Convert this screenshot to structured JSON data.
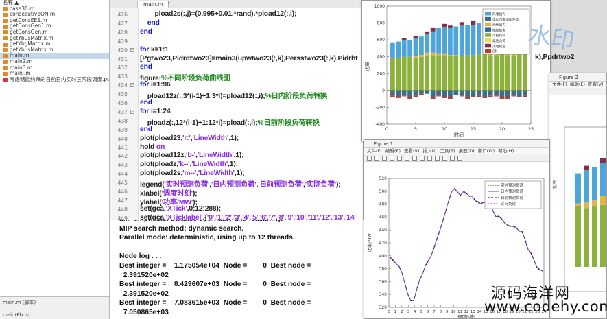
{
  "file_browser": {
    "items": [
      {
        "label": "名称 ▲",
        "type": "header"
      },
      {
        "label": "case30.m",
        "type": "m"
      },
      {
        "label": "consecutiveON.m",
        "type": "m"
      },
      {
        "label": "getConsEES.m",
        "type": "m"
      },
      {
        "label": "getConsGen1.m",
        "type": "m"
      },
      {
        "label": "getConsGen.m",
        "type": "m"
      },
      {
        "label": "getYbusMatrix.m",
        "type": "m"
      },
      {
        "label": "getYbgMatrix.m",
        "type": "m"
      },
      {
        "label": "getYbusMatrix.m",
        "type": "m"
      },
      {
        "label": "main.m",
        "type": "m",
        "selected": true
      },
      {
        "label": "main2.m",
        "type": "m"
      },
      {
        "label": "main3.m",
        "type": "m"
      },
      {
        "label": "mainj.m",
        "type": "m"
      },
      {
        "label": "考虑储能约束的日前日内实时三阶段调度.pdf",
        "type": "pdf"
      }
    ],
    "status_title": "main.m (脚本)",
    "status_sub": "main(Pbus)"
  },
  "editor": {
    "tab": "main.m",
    "tab_plus": "+",
    "lines": [
      {
        "n": "426",
        "fold": "",
        "t": [
          {
            "c": "",
            "s": "        pload2s(:,j)=(0.995+0.01.*rand).*pload12(:,i);"
          }
        ]
      },
      {
        "n": "427",
        "fold": "",
        "t": [
          {
            "c": "kw",
            "s": "    end"
          }
        ]
      },
      {
        "n": "428",
        "fold": "",
        "t": [
          {
            "c": "kw",
            "s": "end"
          }
        ]
      },
      {
        "n": "429",
        "fold": "",
        "t": [
          {
            "c": "",
            "s": ""
          }
        ]
      },
      {
        "n": "430",
        "fold": "−",
        "t": [
          {
            "c": "kw",
            "s": "for "
          },
          {
            "c": "",
            "s": "k=1:1"
          }
        ]
      },
      {
        "n": "431",
        "fold": "",
        "t": [
          {
            "c": "",
            "s": "[Pgtwo23,Pidrdtwo23]=main3(upwtwo23(:,k),Persstwo23(:,k),Pidrbt"
          }
        ]
      },
      {
        "n": "432",
        "fold": "",
        "t": [
          {
            "c": "kw",
            "s": "end"
          }
        ]
      },
      {
        "n": "433",
        "fold": "",
        "t": [
          {
            "c": "",
            "s": "figure;"
          },
          {
            "c": "cmt",
            "s": "%不同阶段负荷曲线图"
          }
        ]
      },
      {
        "n": "434",
        "fold": "−",
        "t": [
          {
            "c": "kw",
            "s": "for "
          },
          {
            "c": "",
            "s": "i=1:96"
          }
        ]
      },
      {
        "n": "435",
        "fold": "",
        "t": [
          {
            "c": "",
            "s": "    pload12z(:,3*(i-1)+1:3*i)=pload12(:,i);"
          },
          {
            "c": "cmt",
            "s": "%日内阶段负荷转换"
          }
        ]
      },
      {
        "n": "436",
        "fold": "",
        "t": [
          {
            "c": "kw",
            "s": "end"
          }
        ]
      },
      {
        "n": "437",
        "fold": "−",
        "t": [
          {
            "c": "kw",
            "s": "for "
          },
          {
            "c": "",
            "s": "i=1:24"
          }
        ]
      },
      {
        "n": "438",
        "fold": "",
        "t": [
          {
            "c": "",
            "s": "    ploadz(:,12*(i-1)+1:12*i)=pload(:,i);"
          },
          {
            "c": "cmt",
            "s": "%日前阶段负荷转换"
          }
        ]
      },
      {
        "n": "439",
        "fold": "",
        "t": [
          {
            "c": "kw",
            "s": "end"
          }
        ]
      },
      {
        "n": "440",
        "fold": "",
        "t": [
          {
            "c": "",
            "s": "plot(pload23,"
          },
          {
            "c": "str",
            "s": "'r:'"
          },
          {
            "c": "",
            "s": ","
          },
          {
            "c": "str",
            "s": "'LineWidth'"
          },
          {
            "c": "",
            "s": ",1);"
          }
        ]
      },
      {
        "n": "441",
        "fold": "",
        "t": [
          {
            "c": "",
            "s": "hold "
          },
          {
            "c": "str",
            "s": "on"
          }
        ]
      },
      {
        "n": "442",
        "fold": "",
        "t": [
          {
            "c": "",
            "s": "plot(pload12z,"
          },
          {
            "c": "str",
            "s": "'b-'"
          },
          {
            "c": "",
            "s": ","
          },
          {
            "c": "str",
            "s": "'LineWidth'"
          },
          {
            "c": "",
            "s": ",1);"
          }
        ]
      },
      {
        "n": "443",
        "fold": "",
        "t": [
          {
            "c": "",
            "s": "plot(ploadz,"
          },
          {
            "c": "str",
            "s": "'k--'"
          },
          {
            "c": "",
            "s": ","
          },
          {
            "c": "str",
            "s": "'LineWidth'"
          },
          {
            "c": "",
            "s": ",1);"
          }
        ]
      },
      {
        "n": "444",
        "fold": "",
        "t": [
          {
            "c": "",
            "s": "plot(pload2s,"
          },
          {
            "c": "str",
            "s": "'m--'"
          },
          {
            "c": "",
            "s": ","
          },
          {
            "c": "str",
            "s": "'LineWidth'"
          },
          {
            "c": "",
            "s": ",1);"
          }
        ]
      },
      {
        "n": "445",
        "fold": "",
        "t": [
          {
            "c": "",
            "s": "legend("
          },
          {
            "c": "str",
            "s": "'实时预测负荷'"
          },
          {
            "c": "",
            "s": ","
          },
          {
            "c": "str",
            "s": "'日内预测负荷'"
          },
          {
            "c": "",
            "s": ","
          },
          {
            "c": "str",
            "s": "'日前预测负荷'"
          },
          {
            "c": "",
            "s": ","
          },
          {
            "c": "str",
            "s": "'实际负荷'"
          },
          {
            "c": "",
            "s": ");"
          }
        ]
      },
      {
        "n": "446",
        "fold": "",
        "t": [
          {
            "c": "",
            "s": "xlabel("
          },
          {
            "c": "str",
            "s": "'调度时刻'"
          },
          {
            "c": "",
            "s": ");"
          }
        ]
      },
      {
        "n": "447",
        "fold": "",
        "t": [
          {
            "c": "",
            "s": "ylabel("
          },
          {
            "c": "str",
            "s": "'功率/MW'"
          },
          {
            "c": "",
            "s": ");"
          }
        ]
      },
      {
        "n": "448",
        "fold": "",
        "t": [
          {
            "c": "",
            "s": "set(gca,"
          },
          {
            "c": "str",
            "s": "'XTick'"
          },
          {
            "c": "",
            "s": ",0:12:288);"
          }
        ]
      },
      {
        "n": "449",
        "fold": "",
        "t": [
          {
            "c": "",
            "s": "set(gca,"
          },
          {
            "c": "str",
            "s": "'XTicklabel'"
          },
          {
            "c": "",
            "s": ",{"
          },
          {
            "c": "str",
            "s": "'0','1','2','3','4','5','6','7','8','9','10','11','12','13','14'"
          }
        ]
      }
    ],
    "overflow_text": "k),Ppdrtwo2"
  },
  "command_window": {
    "lines": [
      "MIP emphasis: balance optimality and feasibility.",
      "MIP search method: dynamic search.",
      "Parallel mode: deterministic, using up to 12 threads.",
      "",
      "Node log . . .",
      "Best integer =    1.175054e+04  Node =        0  Best node =",
      "  2.391520e+02",
      "Best integer =    8.429607e+03  Node =        0  Best node =",
      "  2.391520e+02",
      "Best integer =    7.083615e+03  Node =        0  Best node =",
      "  7.050865e+03"
    ]
  },
  "figure1": {
    "ylabel": "功率",
    "xlabel": "时间",
    "chart_data": {
      "type": "bar",
      "x": [
        1,
        2,
        3,
        4,
        5,
        6,
        7,
        8,
        9,
        10,
        11,
        12,
        13,
        14,
        15,
        16,
        17,
        18,
        19,
        20,
        21,
        22,
        23,
        24
      ],
      "xlim": [
        0,
        25
      ],
      "xticks": [
        "0",
        "5",
        "10",
        "15",
        "20",
        "25"
      ],
      "ylim": [
        -400,
        1000
      ],
      "yticks": [
        "-400",
        "-200",
        "0",
        "200",
        "400",
        "600",
        "800",
        "1000"
      ],
      "legend": [
        "风电出力",
        "电动汽车储能充电",
        "光伏出力",
        "储能放电",
        "可控负荷",
        "柔性负荷",
        "火电机组",
        "ON"
      ],
      "series": [
        {
          "name": "火电机组",
          "color": "#8bb23a",
          "values": [
            390,
            390,
            400,
            400,
            390,
            400,
            410,
            420,
            420,
            420,
            410,
            410,
            410,
            420,
            420,
            430,
            440,
            420,
            420,
            430,
            420,
            420,
            430,
            440
          ]
        },
        {
          "name": "储能放电",
          "color": "#e3b44a",
          "values": [
            0,
            0,
            0,
            0,
            20,
            20,
            40,
            30,
            20,
            20,
            10,
            10,
            0,
            0,
            0,
            0,
            10,
            10,
            20,
            30,
            40,
            50,
            60,
            60
          ]
        },
        {
          "name": "风电出力",
          "color": "#4ea5d9",
          "values": [
            180,
            190,
            200,
            200,
            210,
            220,
            220,
            250,
            300,
            310,
            320,
            340,
            360,
            360,
            360,
            370,
            380,
            400,
            420,
            430,
            440,
            430,
            430,
            440
          ]
        },
        {
          "name": "柔性负荷",
          "color": "#8a2c45",
          "values": [
            0,
            0,
            20,
            0,
            30,
            0,
            30,
            40,
            0,
            40,
            30,
            0,
            40,
            0,
            50,
            0,
            40,
            0,
            30,
            40,
            0,
            50,
            40,
            0
          ]
        },
        {
          "name": "电动汽车储能充电",
          "color": "#3a6e8a",
          "values": [
            -60,
            -70,
            -60,
            -80,
            -60,
            -40,
            -40,
            -80,
            -60,
            -70,
            -80,
            -50,
            -60,
            -80,
            -70,
            -60,
            -80,
            -60,
            -60,
            -80,
            -80,
            -60,
            -70,
            -60
          ]
        },
        {
          "name": "ON",
          "color": "#c03a2a",
          "values": [
            -20,
            -20,
            -10,
            -20,
            -20,
            -10,
            0,
            -20,
            -10,
            -20,
            -20,
            0,
            -10,
            -20,
            -10,
            -20,
            -10,
            -20,
            -10,
            -20,
            -20,
            -10,
            -10,
            -20
          ]
        }
      ]
    }
  },
  "figure2": {
    "title": "Figure 1",
    "menu": [
      "文件(F)",
      "编辑(E)",
      "查看(V)",
      "插入(I)",
      "工具(T)",
      "桌面(D)",
      "窗口(W)",
      "帮助(H)"
    ],
    "ylabel": "功率/MW",
    "xlabel": "调度时刻",
    "chart_data": {
      "type": "line",
      "ylim": [
        320,
        520
      ],
      "yticks": [
        "320",
        "340",
        "360",
        "380",
        "400",
        "420",
        "440",
        "460",
        "480",
        "500",
        "520"
      ],
      "xticks": [
        "0",
        "1",
        "2",
        "3",
        "4",
        "5",
        "6",
        "7",
        "8",
        "9",
        "10",
        "11",
        "12",
        "13",
        "14",
        "15",
        "16",
        "17",
        "18",
        "19",
        "20",
        "21",
        "22",
        "23",
        "24"
      ],
      "legend": [
        "实时预测负荷",
        "日内预测负荷",
        "日前预测负荷",
        "实际负荷"
      ],
      "series": [
        {
          "name": "实时预测负荷",
          "color": "#333333",
          "values": [
            397,
            393,
            388,
            383,
            374,
            357,
            340,
            330,
            331,
            348,
            362,
            372,
            384,
            392,
            401,
            413,
            427,
            440,
            455,
            470,
            487,
            500,
            504,
            499,
            493,
            500,
            497,
            492,
            493,
            486,
            483,
            480,
            484,
            480,
            478,
            470,
            460,
            462,
            458,
            452,
            447,
            445,
            446,
            444,
            438,
            438,
            425,
            410,
            405,
            395,
            382,
            378,
            377
          ]
        },
        {
          "name": "日内预测负荷",
          "color": "#2b3cc8",
          "values": [
            398,
            393,
            387,
            384,
            373,
            358,
            341,
            331,
            330,
            347,
            363,
            371,
            385,
            393,
            400,
            414,
            428,
            441,
            455,
            471,
            486,
            499,
            505,
            498,
            494,
            499,
            496,
            493,
            492,
            485,
            484,
            480,
            483,
            481,
            477,
            471,
            461,
            461,
            457,
            451,
            448,
            446,
            445,
            443,
            439,
            437,
            426,
            411,
            404,
            394,
            383,
            379,
            376
          ]
        },
        {
          "name": "日前预测负荷",
          "color": "#000000",
          "values": [
            398,
            392,
            388,
            383,
            373,
            357,
            340,
            330,
            331,
            347,
            361,
            372,
            384,
            392,
            401,
            412,
            426,
            440,
            454,
            470,
            486,
            500,
            503,
            499,
            493,
            500,
            497,
            492,
            493,
            486,
            482,
            481,
            484,
            479,
            478,
            470,
            461,
            461,
            458,
            452,
            447,
            446,
            446,
            444,
            438,
            438,
            425,
            410,
            405,
            395,
            382,
            378,
            377
          ]
        },
        {
          "name": "实际负荷",
          "color": "#c03ac0",
          "values": [
            397,
            394,
            388,
            384,
            374,
            356,
            340,
            331,
            331,
            348,
            362,
            371,
            384,
            393,
            401,
            413,
            427,
            440,
            456,
            470,
            487,
            500,
            504,
            499,
            494,
            500,
            497,
            492,
            492,
            486,
            483,
            480,
            484,
            480,
            478,
            470,
            460,
            462,
            458,
            452,
            447,
            445,
            446,
            443,
            438,
            438,
            425,
            410,
            406,
            395,
            382,
            378,
            377
          ]
        }
      ]
    }
  },
  "figure3": {
    "title": "Figure 2",
    "menu": [
      "文件(F)",
      "编辑(E)",
      "查看(V)"
    ],
    "ylabel": "功率"
  },
  "watermarks": {
    "top_right": "水印",
    "bottom_cn": "源码海洋网",
    "bottom_url": "www.codehy.com"
  }
}
